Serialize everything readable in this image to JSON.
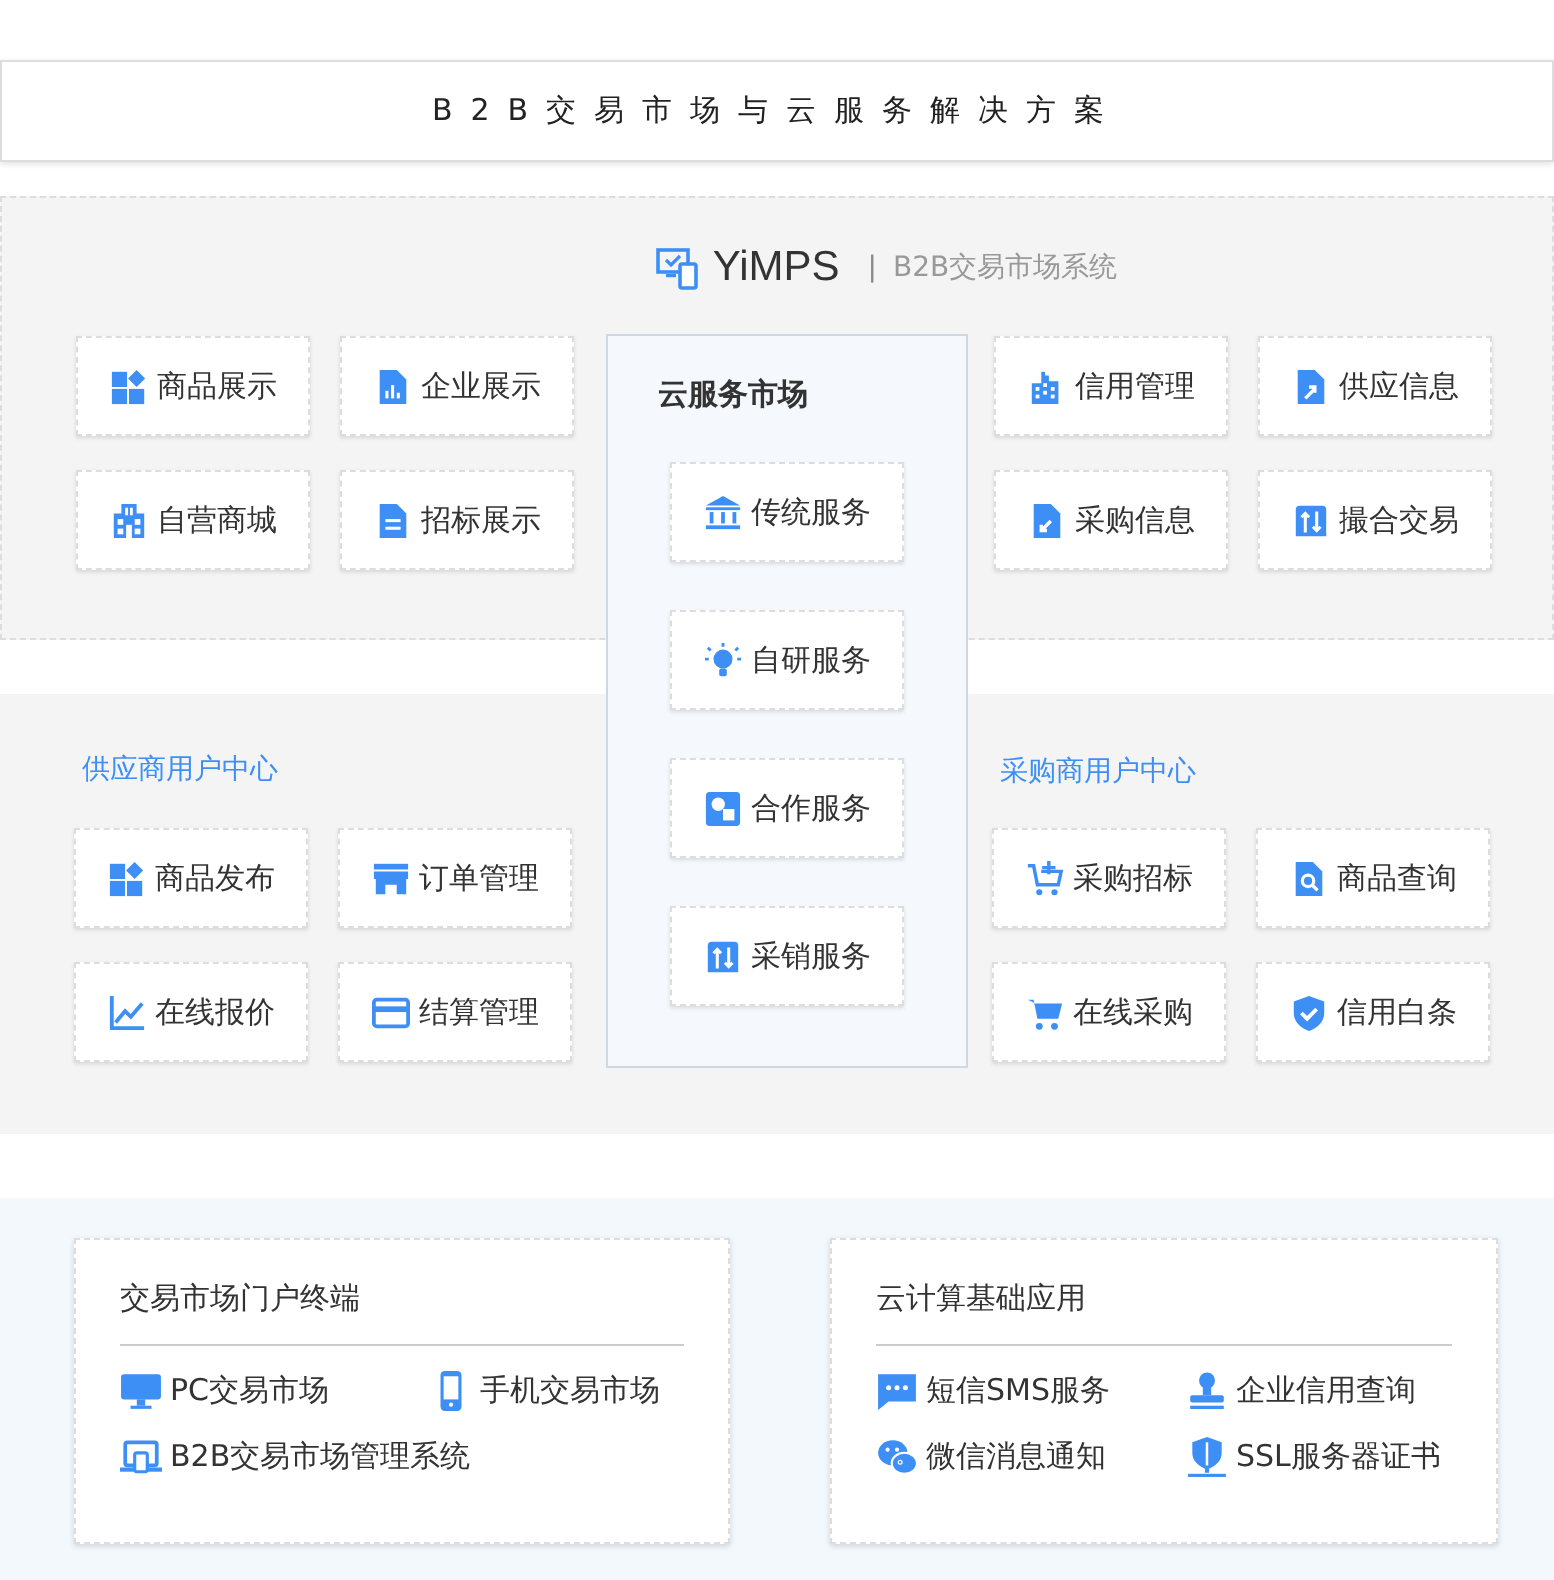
{
  "header": {
    "title": "B2B交易市场与云服务解决方案"
  },
  "system": {
    "logo": "YiMPS",
    "separator": "|",
    "subtitle": "B2B交易市场系统"
  },
  "top_left_tiles": [
    "商品展示",
    "企业展示",
    "自营商城",
    "招标展示"
  ],
  "top_right_tiles": [
    "信用管理",
    "供应信息",
    "采购信息",
    "撮合交易"
  ],
  "cloud_market": {
    "title": "云服务市场",
    "tiles": [
      "传统服务",
      "自研服务",
      "合作服务",
      "采销服务"
    ]
  },
  "supplier_center": {
    "title": "供应商用户中心",
    "tiles": [
      "商品发布",
      "订单管理",
      "在线报价",
      "结算管理"
    ]
  },
  "buyer_center": {
    "title": "采购商用户中心",
    "tiles": [
      "采购招标",
      "商品查询",
      "在线采购",
      "信用白条"
    ]
  },
  "bottom_cards": [
    {
      "title": "交易市场门户终端",
      "items": [
        "PC交易市场",
        "手机交易市场",
        "B2B交易市场管理系统"
      ]
    },
    {
      "title": "云计算基础应用",
      "items": [
        "短信SMS服务",
        "企业信用查询",
        "微信消息通知",
        "SSL服务器证书"
      ]
    }
  ]
}
